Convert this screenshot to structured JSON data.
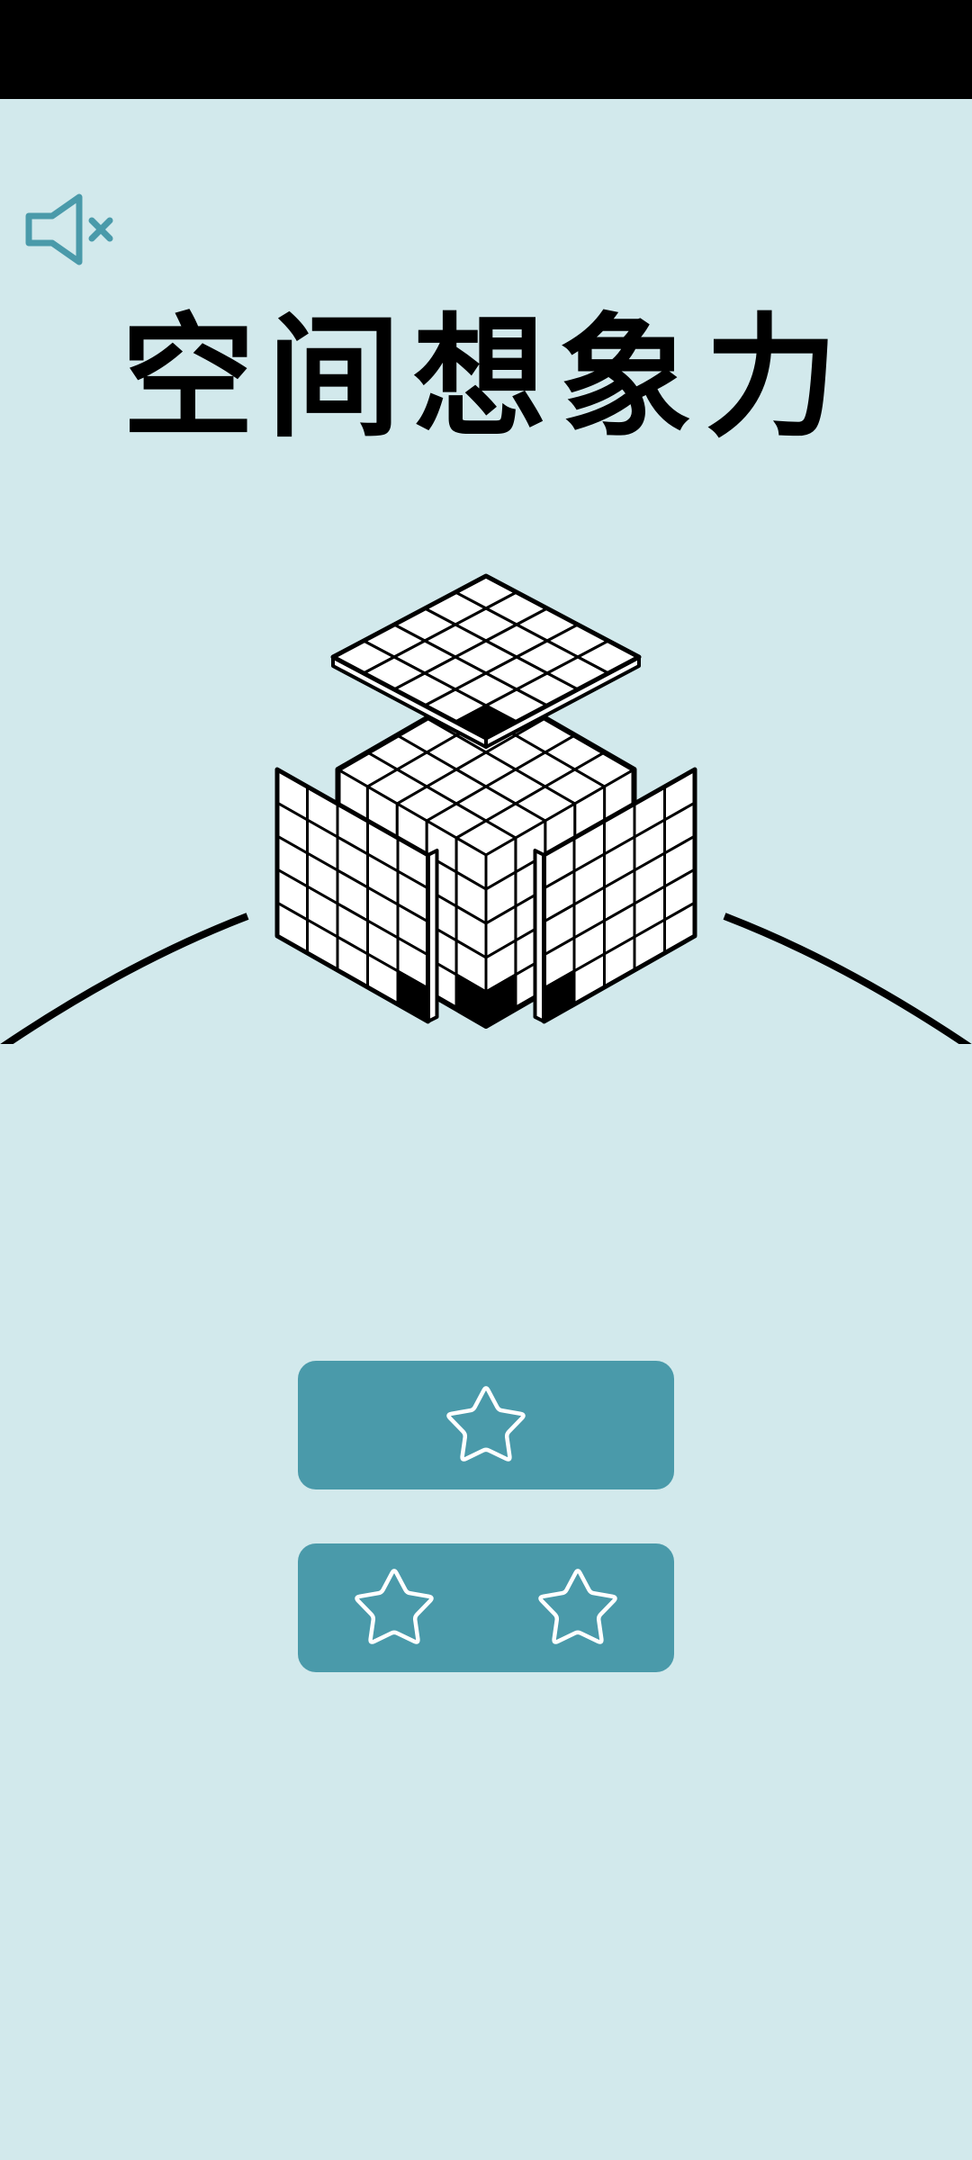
{
  "title": "空间想象力",
  "mute_button": {
    "icon": "speaker-muted-icon",
    "color": "#4a9aaa"
  },
  "levels": [
    {
      "id": "level-1",
      "stars": 1,
      "icon": "star-outline-icon"
    },
    {
      "id": "level-2",
      "stars": 2,
      "icon": "star-outline-icon"
    }
  ],
  "colors": {
    "background": "#d2e9ec",
    "button": "#4a9aaa",
    "ink": "#000000",
    "paper": "#ffffff"
  }
}
